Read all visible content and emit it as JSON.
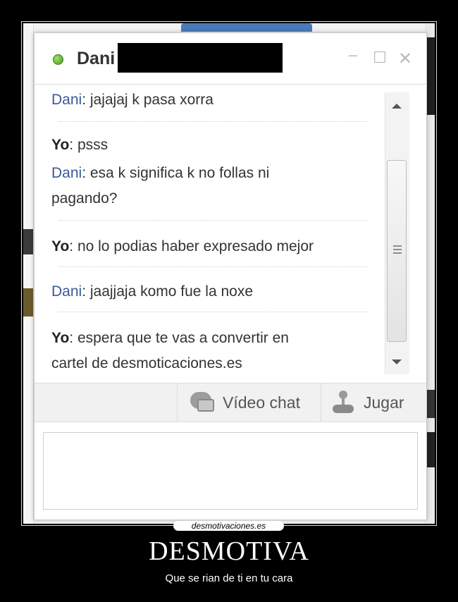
{
  "chat": {
    "contact_name": "Dani",
    "controls": {
      "minimize": "–",
      "maximize": "☐",
      "close": "✕"
    },
    "messages": [
      {
        "sender": "Dani",
        "text": ": jajajaj k pasa xorra"
      },
      {
        "sender": "Yo",
        "text": ": psss"
      },
      {
        "sender": "Dani",
        "text": ": esa k significa k no follas ni"
      },
      {
        "sender": "",
        "text": "pagando?"
      },
      {
        "sender": "Yo",
        "text": ": no lo podias haber expresado mejor"
      },
      {
        "sender": "Dani",
        "text": ": jaajjaja komo fue la noxe"
      },
      {
        "sender": "Yo",
        "text": ": espera que te vas a convertir en"
      },
      {
        "sender": "",
        "text": "cartel de desmoticaciones.es"
      }
    ],
    "actions": {
      "video_chat": "Vídeo chat",
      "play": "Jugar"
    },
    "compose_value": ""
  },
  "poster": {
    "site": "desmotivaciones.es",
    "title": "DESMOTIVA",
    "caption": "Que se rian de ti en tu cara"
  }
}
